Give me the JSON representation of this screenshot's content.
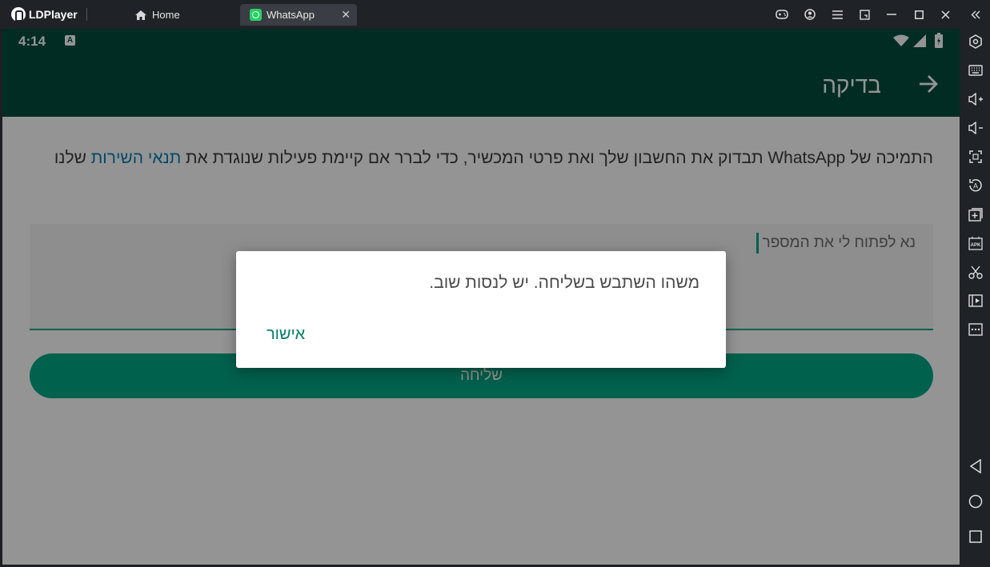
{
  "emulator": {
    "brand": "LDPlayer",
    "tabs": [
      {
        "label": "Home"
      },
      {
        "label": "WhatsApp"
      }
    ]
  },
  "status_bar": {
    "time": "4:14",
    "notification": "A"
  },
  "app_bar": {
    "title": "בדיקה"
  },
  "content": {
    "explanation_prefix": "התמיכה של WhatsApp תבדוק את החשבון שלך ואת פרטי המכשיר, כדי לברר אם קיימת פעילות שנוגדת את ",
    "tos_link": "תנאי השירות",
    "explanation_suffix": " שלנו",
    "phone_placeholder": "נא לפתוח לי את המספר",
    "send_button": "שליחה"
  },
  "dialog": {
    "message": "משהו השתבש בשליחה. יש לנסות שוב.",
    "ok_button": "אישור"
  },
  "colors": {
    "whatsapp_dark_teal": "#004d3f",
    "whatsapp_green": "#00a884",
    "link_blue": "#027eb5",
    "emulator_chrome": "#1f2226"
  }
}
